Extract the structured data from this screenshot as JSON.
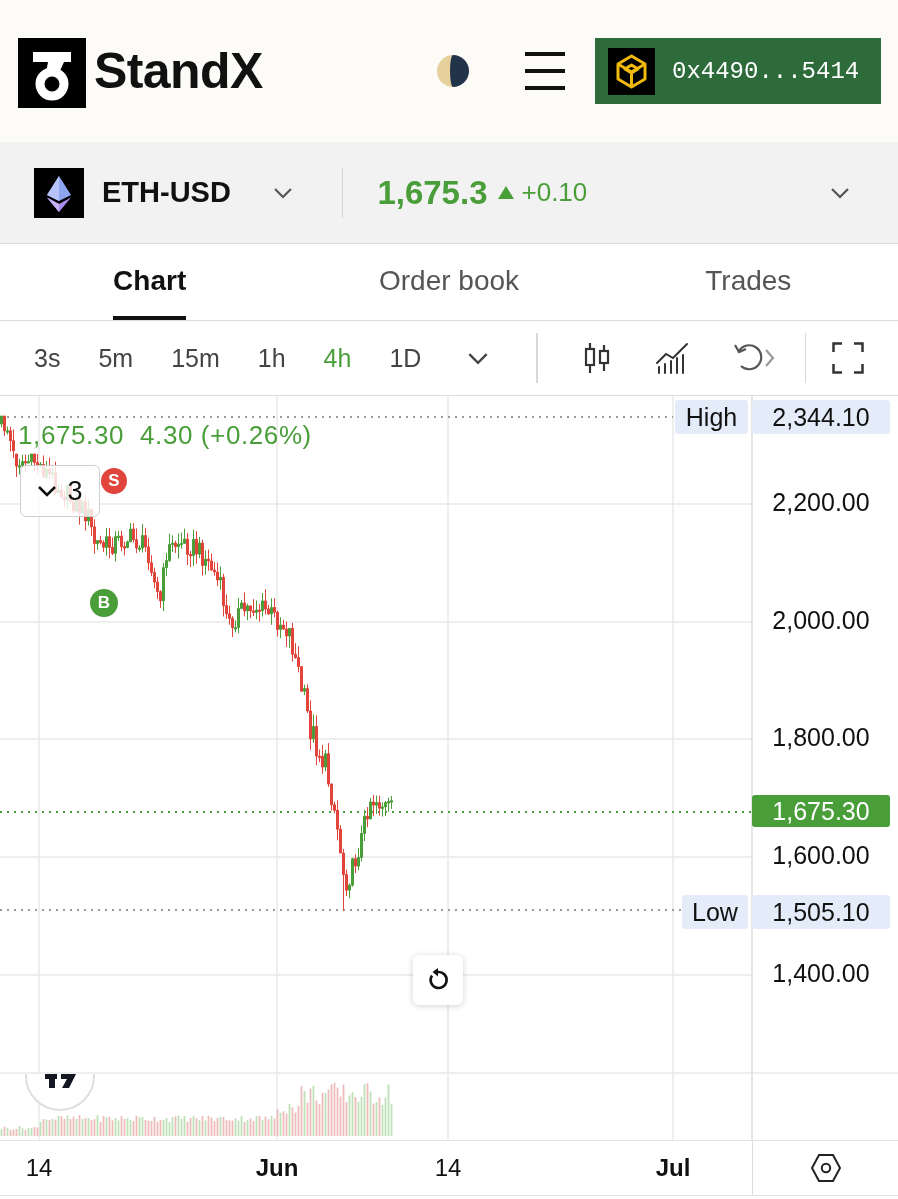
{
  "header": {
    "brand": "StandX",
    "wallet": {
      "address": "0x4490...5414"
    }
  },
  "market": {
    "symbol": "ETH-USD",
    "price": "1,675.3",
    "rising": true,
    "change": "+0.10"
  },
  "tabs": [
    {
      "label": "Chart",
      "selected": true
    },
    {
      "label": "Order book",
      "selected": false
    },
    {
      "label": "Trades",
      "selected": false
    }
  ],
  "intervals": [
    {
      "label": "3s",
      "selected": false
    },
    {
      "label": "5m",
      "selected": false
    },
    {
      "label": "15m",
      "selected": false
    },
    {
      "label": "1h",
      "selected": false
    },
    {
      "label": "4h",
      "selected": true
    },
    {
      "label": "1D",
      "selected": false
    }
  ],
  "chart": {
    "legend": {
      "price": "1,675.30",
      "change": "4.30 (+0.26%)"
    },
    "marker_group": {
      "count": "3"
    },
    "trade_markers": [
      {
        "kind": "sell",
        "label": "S"
      },
      {
        "kind": "buy",
        "label": "B"
      }
    ],
    "price_axis": [
      "2,200.00",
      "2,000.00",
      "1,800.00",
      "1,600.00",
      "1,400.00"
    ],
    "high": {
      "label": "High",
      "value": "2,344.10"
    },
    "last_price": "1,675.30",
    "low": {
      "label": "Low",
      "value": "1,505.10"
    },
    "time_axis": [
      {
        "label": "14",
        "kind": "day"
      },
      {
        "label": "Jun",
        "kind": "month"
      },
      {
        "label": "14",
        "kind": "day"
      },
      {
        "label": "Jul",
        "kind": "month"
      }
    ]
  }
}
